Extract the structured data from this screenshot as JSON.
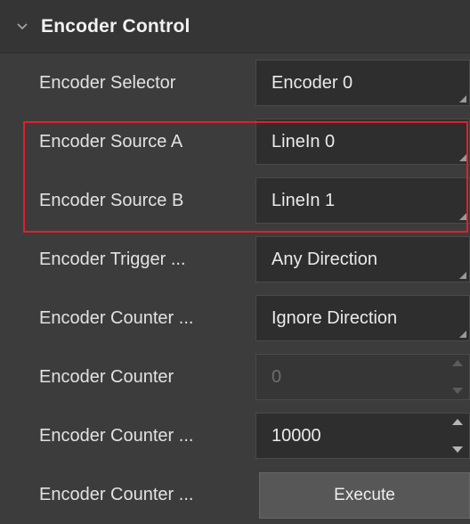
{
  "section": {
    "title": "Encoder Control",
    "expanded": true
  },
  "rows": [
    {
      "label": "Encoder Selector",
      "value": "Encoder 0",
      "type": "dropdown"
    },
    {
      "label": "Encoder Source A",
      "value": "LineIn 0",
      "type": "dropdown"
    },
    {
      "label": "Encoder Source B",
      "value": "LineIn 1",
      "type": "dropdown"
    },
    {
      "label": "Encoder Trigger ...",
      "value": "Any Direction",
      "type": "dropdown"
    },
    {
      "label": "Encoder Counter ...",
      "value": "Ignore Direction",
      "type": "dropdown"
    },
    {
      "label": "Encoder Counter",
      "value": "0",
      "type": "spinner",
      "disabled": true
    },
    {
      "label": "Encoder Counter ...",
      "value": "10000",
      "type": "spinner"
    },
    {
      "label": "Encoder Counter ...",
      "button_label": "Execute",
      "type": "button"
    }
  ],
  "colors": {
    "background": "#3c3c3c",
    "field": "#2e2e2e",
    "highlight": "#e0202a",
    "button": "#575757"
  }
}
